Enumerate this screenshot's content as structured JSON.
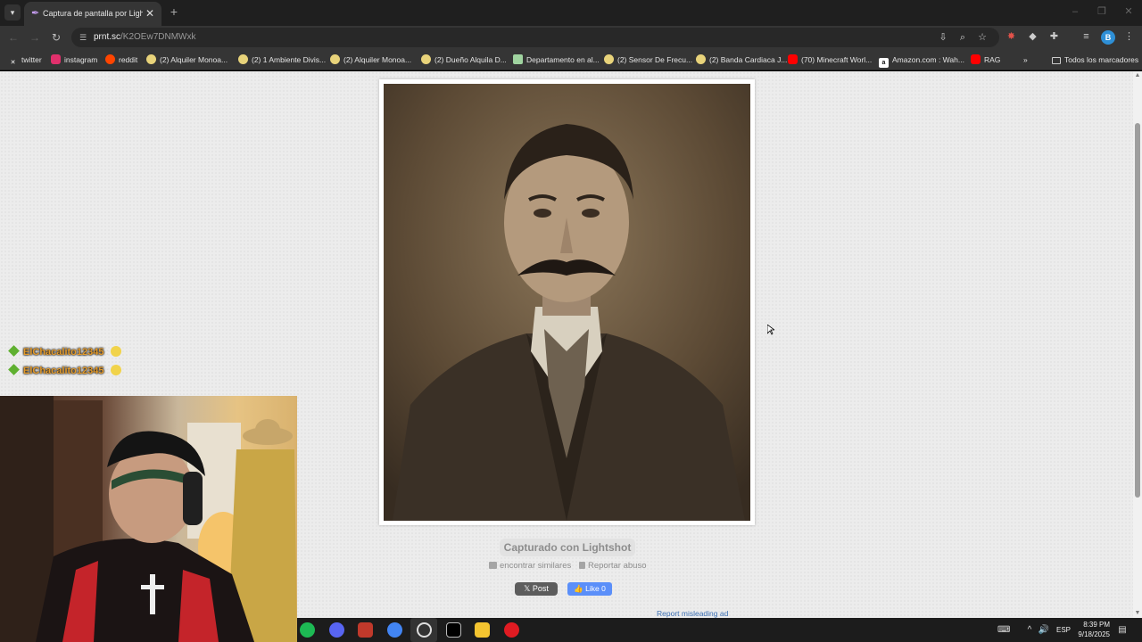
{
  "browser": {
    "tab_title": "Captura de pantalla por Lightsh",
    "url_host": "prnt.sc",
    "url_path": "/K2OEw7DNMWxk",
    "profile_initial": "B",
    "icons": {
      "tab_menu": "chevron-down-icon",
      "favicon": "feather-icon",
      "close": "close-icon",
      "new_tab": "plus-icon",
      "back": "arrow-left-icon",
      "forward": "arrow-right-icon",
      "reload": "reload-icon",
      "site_info": "tune-icon"
    }
  },
  "bookmarks": [
    {
      "label": "twitter",
      "icon": "x-logo-icon",
      "color": "#ffffff"
    },
    {
      "label": "instagram",
      "icon": "instagram-icon",
      "color": "#e1306c"
    },
    {
      "label": "reddit",
      "icon": "reddit-icon",
      "color": "#ff4500"
    },
    {
      "label": "(2) Alquiler Monoa...",
      "icon": "listing-icon",
      "color": "#e8d37a"
    },
    {
      "label": "(2) 1 Ambiente Divis...",
      "icon": "listing-icon",
      "color": "#e8d37a"
    },
    {
      "label": "(2) Alquiler Monoa...",
      "icon": "listing-icon",
      "color": "#e8d37a"
    },
    {
      "label": "(2) Dueño Alquila D...",
      "icon": "listing-icon",
      "color": "#e8d37a"
    },
    {
      "label": "Departamento en al...",
      "icon": "image-icon",
      "color": "#9fd39f"
    },
    {
      "label": "(2) Sensor De Frecu...",
      "icon": "listing-icon",
      "color": "#e8d37a"
    },
    {
      "label": "(2) Banda Cardiaca J...",
      "icon": "listing-icon",
      "color": "#e8d37a"
    },
    {
      "label": "(70) Minecraft Worl...",
      "icon": "youtube-icon",
      "color": "#ff0000"
    },
    {
      "label": "Amazon.com : Wah...",
      "icon": "amazon-icon",
      "color": "#ffffff"
    },
    {
      "label": "RAG",
      "icon": "youtube-icon",
      "color": "#ff0000"
    }
  ],
  "bookmarks_more": "»",
  "bookmarks_all": "Todos los marcadores",
  "page": {
    "caption": "Capturado con Lightshot",
    "find_similar": "encontrar similares",
    "report_abuse": "Reportar abuso",
    "post_label": "Post",
    "like_label": "Like 0",
    "report_ad": "Report misleading ad"
  },
  "chat": [
    {
      "name": "ElChacalito12345",
      "colon": ":"
    },
    {
      "name": "ElChacalito12345",
      "colon": ":"
    }
  ],
  "taskbar": {
    "language": "ESP",
    "time": "8:39 PM",
    "date": "9/18/2025"
  },
  "colors": {
    "chat_name": "#e39a2a",
    "chat_badge": "#5fb030",
    "like_button": "#5b8ff9",
    "report_link": "#3b6fb3"
  }
}
